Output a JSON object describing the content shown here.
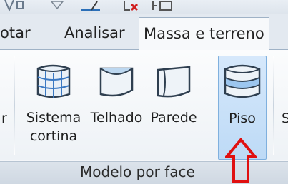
{
  "tabs": [
    {
      "label": "otar",
      "active": false
    },
    {
      "label": "Analisar",
      "active": false
    },
    {
      "label": "Massa e terreno",
      "active": true
    }
  ],
  "panel": {
    "title": "Modelo por face",
    "left_fragment": "r",
    "right_fragment": "S",
    "buttons": [
      {
        "label": "Sistema cortina",
        "icon": "curtain-system-icon",
        "selected": false
      },
      {
        "label": "Telhado",
        "icon": "roof-icon",
        "selected": false
      },
      {
        "label": "Parede",
        "icon": "wall-icon",
        "selected": false
      },
      {
        "label": "Piso",
        "icon": "floor-icon",
        "selected": true
      }
    ]
  },
  "annotation": {
    "icon": "red-up-arrow-icon",
    "color": "#e01010"
  },
  "colors": {
    "accent": "#7fb0de",
    "selected_bg": "#c9e1f8"
  }
}
